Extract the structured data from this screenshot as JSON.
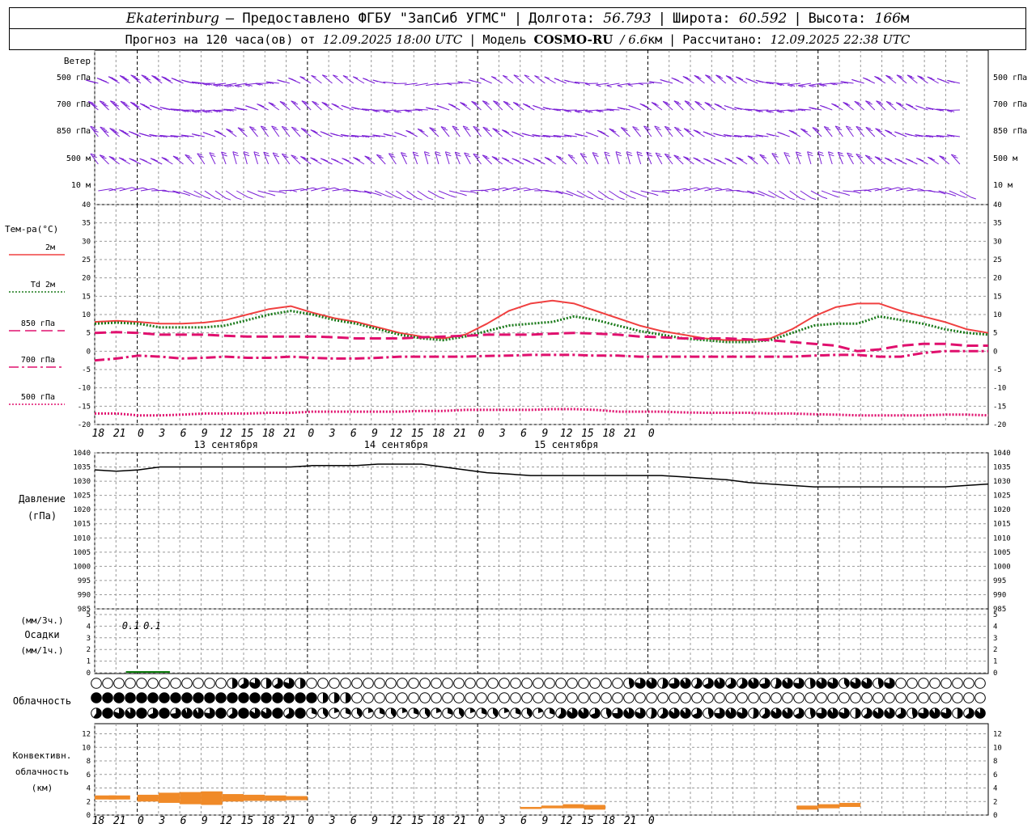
{
  "header": {
    "station": "Ekaterinburg",
    "provider": "— Предоставлено ФГБУ \"ЗапСиб УГМС\"",
    "lon_label": "Долгота:",
    "lon_value": "56.793",
    "lat_label": "Широта:",
    "lat_value": "60.592",
    "alt_label": "Высота:",
    "alt_value": "166",
    "alt_unit": "м",
    "forecast_label": "Прогноз на 120 часа(ов) от",
    "forecast_time": "12.09.2025 18:00 UTC",
    "model_label": "Модель",
    "model_name": "COSMO-RU",
    "model_res": "/ 6.6",
    "model_res_unit": "км",
    "calc_label": "Рассчитано:",
    "calc_time": "12.09.2025 22:38 UTC"
  },
  "wind": {
    "title": "Ветер",
    "levels": [
      "500 гПа",
      "700 гПа",
      "850 гПа",
      "500 м",
      "10 м"
    ],
    "color": "#7a1fd6"
  },
  "temperature": {
    "title": "Тем-ра(°C)",
    "legend": [
      {
        "label": "2м",
        "color": "#f04040",
        "dash": "solid"
      },
      {
        "label": "Td 2м",
        "color": "#1a7a1a",
        "dash": "dotted"
      },
      {
        "label": "850 гПа",
        "color": "#e0106e",
        "dash": "long-dash"
      },
      {
        "label": "700 гПа",
        "color": "#e0106e",
        "dash": "dash-dot"
      },
      {
        "label": "500 гПа",
        "color": "#e0106e",
        "dash": "dotted"
      }
    ],
    "y_ticks": [
      "40",
      "35",
      "30",
      "25",
      "20",
      "15",
      "10",
      "5",
      "0",
      "-5",
      "-10",
      "-15",
      "-20"
    ],
    "ylim": [
      -20,
      40
    ]
  },
  "pressure": {
    "title": "Давление",
    "unit": "(гПа)",
    "y_ticks": [
      "1040",
      "1035",
      "1030",
      "1025",
      "1020",
      "1015",
      "1010",
      "1005",
      "1000",
      "995",
      "990",
      "985"
    ],
    "ylim": [
      985,
      1040
    ]
  },
  "precip": {
    "label_top": "(мм/3ч.)",
    "title": "Осадки",
    "label_bottom": "(мм/1ч.)",
    "y_ticks": [
      "5",
      "4",
      "3",
      "2",
      "1",
      "0"
    ],
    "values_text": [
      "0.1",
      "0.1"
    ]
  },
  "cloud": {
    "title": "Облачность"
  },
  "convective": {
    "title_1": "Конвективн.",
    "title_2": "облачность",
    "unit": "(км)",
    "y_ticks": [
      "12",
      "10",
      "8",
      "6",
      "4",
      "2",
      "0"
    ]
  },
  "time_axis": {
    "tick_labels": [
      "18",
      "21",
      "0",
      "3",
      "6",
      "9",
      "12",
      "15",
      "18",
      "21",
      "0",
      "3",
      "6",
      "9",
      "12",
      "15",
      "18",
      "21",
      "0",
      "3",
      "6",
      "9",
      "12",
      "15",
      "18",
      "21",
      "0"
    ],
    "dates": [
      "13 сентября",
      "14 сентября",
      "15 сентября"
    ]
  },
  "chart_data": {
    "type": "line",
    "x_hours_from_start": [
      0,
      3,
      6,
      9,
      12,
      15,
      18,
      21,
      24,
      27,
      30,
      33,
      36,
      39,
      42,
      45,
      48,
      51,
      54,
      57,
      60,
      63,
      66,
      69,
      72,
      75,
      78,
      81,
      84,
      87,
      90,
      93,
      96,
      99,
      102,
      105,
      108,
      111,
      114,
      117,
      120
    ],
    "series": [
      {
        "name": "2м",
        "values": [
          8,
          8.3,
          8,
          7.5,
          7.5,
          7.8,
          8.5,
          10,
          11.5,
          12.3,
          10.5,
          9,
          8,
          6.5,
          5,
          4,
          3.5,
          4.5,
          7.5,
          11,
          13,
          13.8,
          13,
          11,
          9,
          7,
          5.5,
          4.5,
          3.5,
          3,
          3,
          3.5,
          6,
          9.5,
          12,
          13,
          13,
          11,
          9.5,
          8,
          6,
          5
        ]
      },
      {
        "name": "Td 2м",
        "values": [
          7.5,
          7.8,
          7.5,
          6.5,
          6.5,
          6.5,
          7,
          8.5,
          10,
          11,
          10,
          8.5,
          7.5,
          6,
          4.5,
          3.5,
          3,
          4,
          5.5,
          7,
          7.5,
          8,
          9.5,
          8.5,
          7,
          5.5,
          4.5,
          3.5,
          3,
          2.5,
          2.5,
          3,
          5,
          7,
          7.5,
          7.5,
          9.5,
          8.5,
          7.5,
          6,
          5,
          4.5
        ]
      },
      {
        "name": "850 гПа",
        "values": [
          5,
          5.2,
          5,
          4.5,
          4.5,
          4.5,
          4.2,
          4,
          4,
          4,
          4,
          3.8,
          3.5,
          3.5,
          3.5,
          3.8,
          4,
          4.2,
          4.5,
          4.5,
          4.5,
          4.8,
          5,
          4.8,
          4.5,
          4,
          3.8,
          3.5,
          3.5,
          3.5,
          3.2,
          3,
          2.5,
          2,
          1.5,
          0,
          0.5,
          1.5,
          2,
          2,
          1.5,
          1.5
        ]
      },
      {
        "name": "700 гПа",
        "values": [
          -2.5,
          -2,
          -1.2,
          -1.5,
          -2,
          -1.8,
          -1.5,
          -1.8,
          -1.8,
          -1.5,
          -1.8,
          -2,
          -2,
          -1.8,
          -1.5,
          -1.5,
          -1.5,
          -1.5,
          -1.3,
          -1.2,
          -1,
          -1,
          -1,
          -1.2,
          -1.2,
          -1.5,
          -1.5,
          -1.5,
          -1.5,
          -1.5,
          -1.5,
          -1.5,
          -1.5,
          -1.2,
          -1,
          -1,
          -1.5,
          -1.5,
          -0.5,
          0,
          0,
          0
        ]
      },
      {
        "name": "500 гПа",
        "values": [
          -17,
          -17,
          -17.5,
          -17.5,
          -17.3,
          -17,
          -17,
          -17,
          -16.8,
          -16.8,
          -16.5,
          -16.5,
          -16.5,
          -16.5,
          -16.5,
          -16.3,
          -16.3,
          -16,
          -16,
          -16,
          -16,
          -15.8,
          -15.8,
          -16,
          -16.5,
          -16.5,
          -16.5,
          -16.7,
          -16.8,
          -16.8,
          -16.8,
          -17,
          -17,
          -17.2,
          -17.3,
          -17.5,
          -17.5,
          -17.5,
          -17.5,
          -17.3,
          -17.3,
          -17.5
        ]
      }
    ],
    "pressure_values": [
      1034,
      1033.5,
      1034,
      1035,
      1035,
      1035,
      1035,
      1035,
      1035,
      1035,
      1035.5,
      1035.5,
      1035.5,
      1036,
      1036,
      1036,
      1035,
      1034,
      1033,
      1032.5,
      1032,
      1032,
      1032,
      1032,
      1032,
      1032,
      1032,
      1031.5,
      1031,
      1030.5,
      1029.5,
      1029,
      1028.5,
      1028,
      1028,
      1028,
      1028,
      1028,
      1028,
      1028,
      1028.5,
      1029
    ],
    "precip_mm": [
      0,
      0,
      0.1,
      0.1,
      0,
      0,
      0,
      0,
      0,
      0,
      0,
      0,
      0,
      0,
      0,
      0,
      0,
      0,
      0,
      0,
      0,
      0,
      0,
      0,
      0,
      0,
      0,
      0,
      0,
      0,
      0,
      0,
      0,
      0,
      0,
      0,
      0,
      0,
      0,
      0,
      0
    ],
    "convective_tops_km_at_hours": [
      {
        "hour": 0,
        "base": 2.3,
        "top": 2.9
      },
      {
        "hour": 2,
        "base": 2.3,
        "top": 2.9
      },
      {
        "hour": 6,
        "base": 2.0,
        "top": 3.0
      },
      {
        "hour": 9,
        "base": 1.8,
        "top": 3.3
      },
      {
        "hour": 12,
        "base": 1.6,
        "top": 3.4
      },
      {
        "hour": 15,
        "base": 1.5,
        "top": 3.5
      },
      {
        "hour": 18,
        "base": 2.0,
        "top": 3.1
      },
      {
        "hour": 21,
        "base": 2.1,
        "top": 3.0
      },
      {
        "hour": 24,
        "base": 2.1,
        "top": 2.9
      },
      {
        "hour": 27,
        "base": 2.2,
        "top": 2.8
      },
      {
        "hour": 60,
        "base": 0.9,
        "top": 1.2
      },
      {
        "hour": 63,
        "base": 1.0,
        "top": 1.4
      },
      {
        "hour": 66,
        "base": 1.0,
        "top": 1.6
      },
      {
        "hour": 69,
        "base": 0.8,
        "top": 1.5
      },
      {
        "hour": 99,
        "base": 0.8,
        "top": 1.4
      },
      {
        "hour": 102,
        "base": 1.0,
        "top": 1.6
      },
      {
        "hour": 105,
        "base": 1.2,
        "top": 1.8
      }
    ],
    "xlabel": "",
    "ylabel": ""
  }
}
